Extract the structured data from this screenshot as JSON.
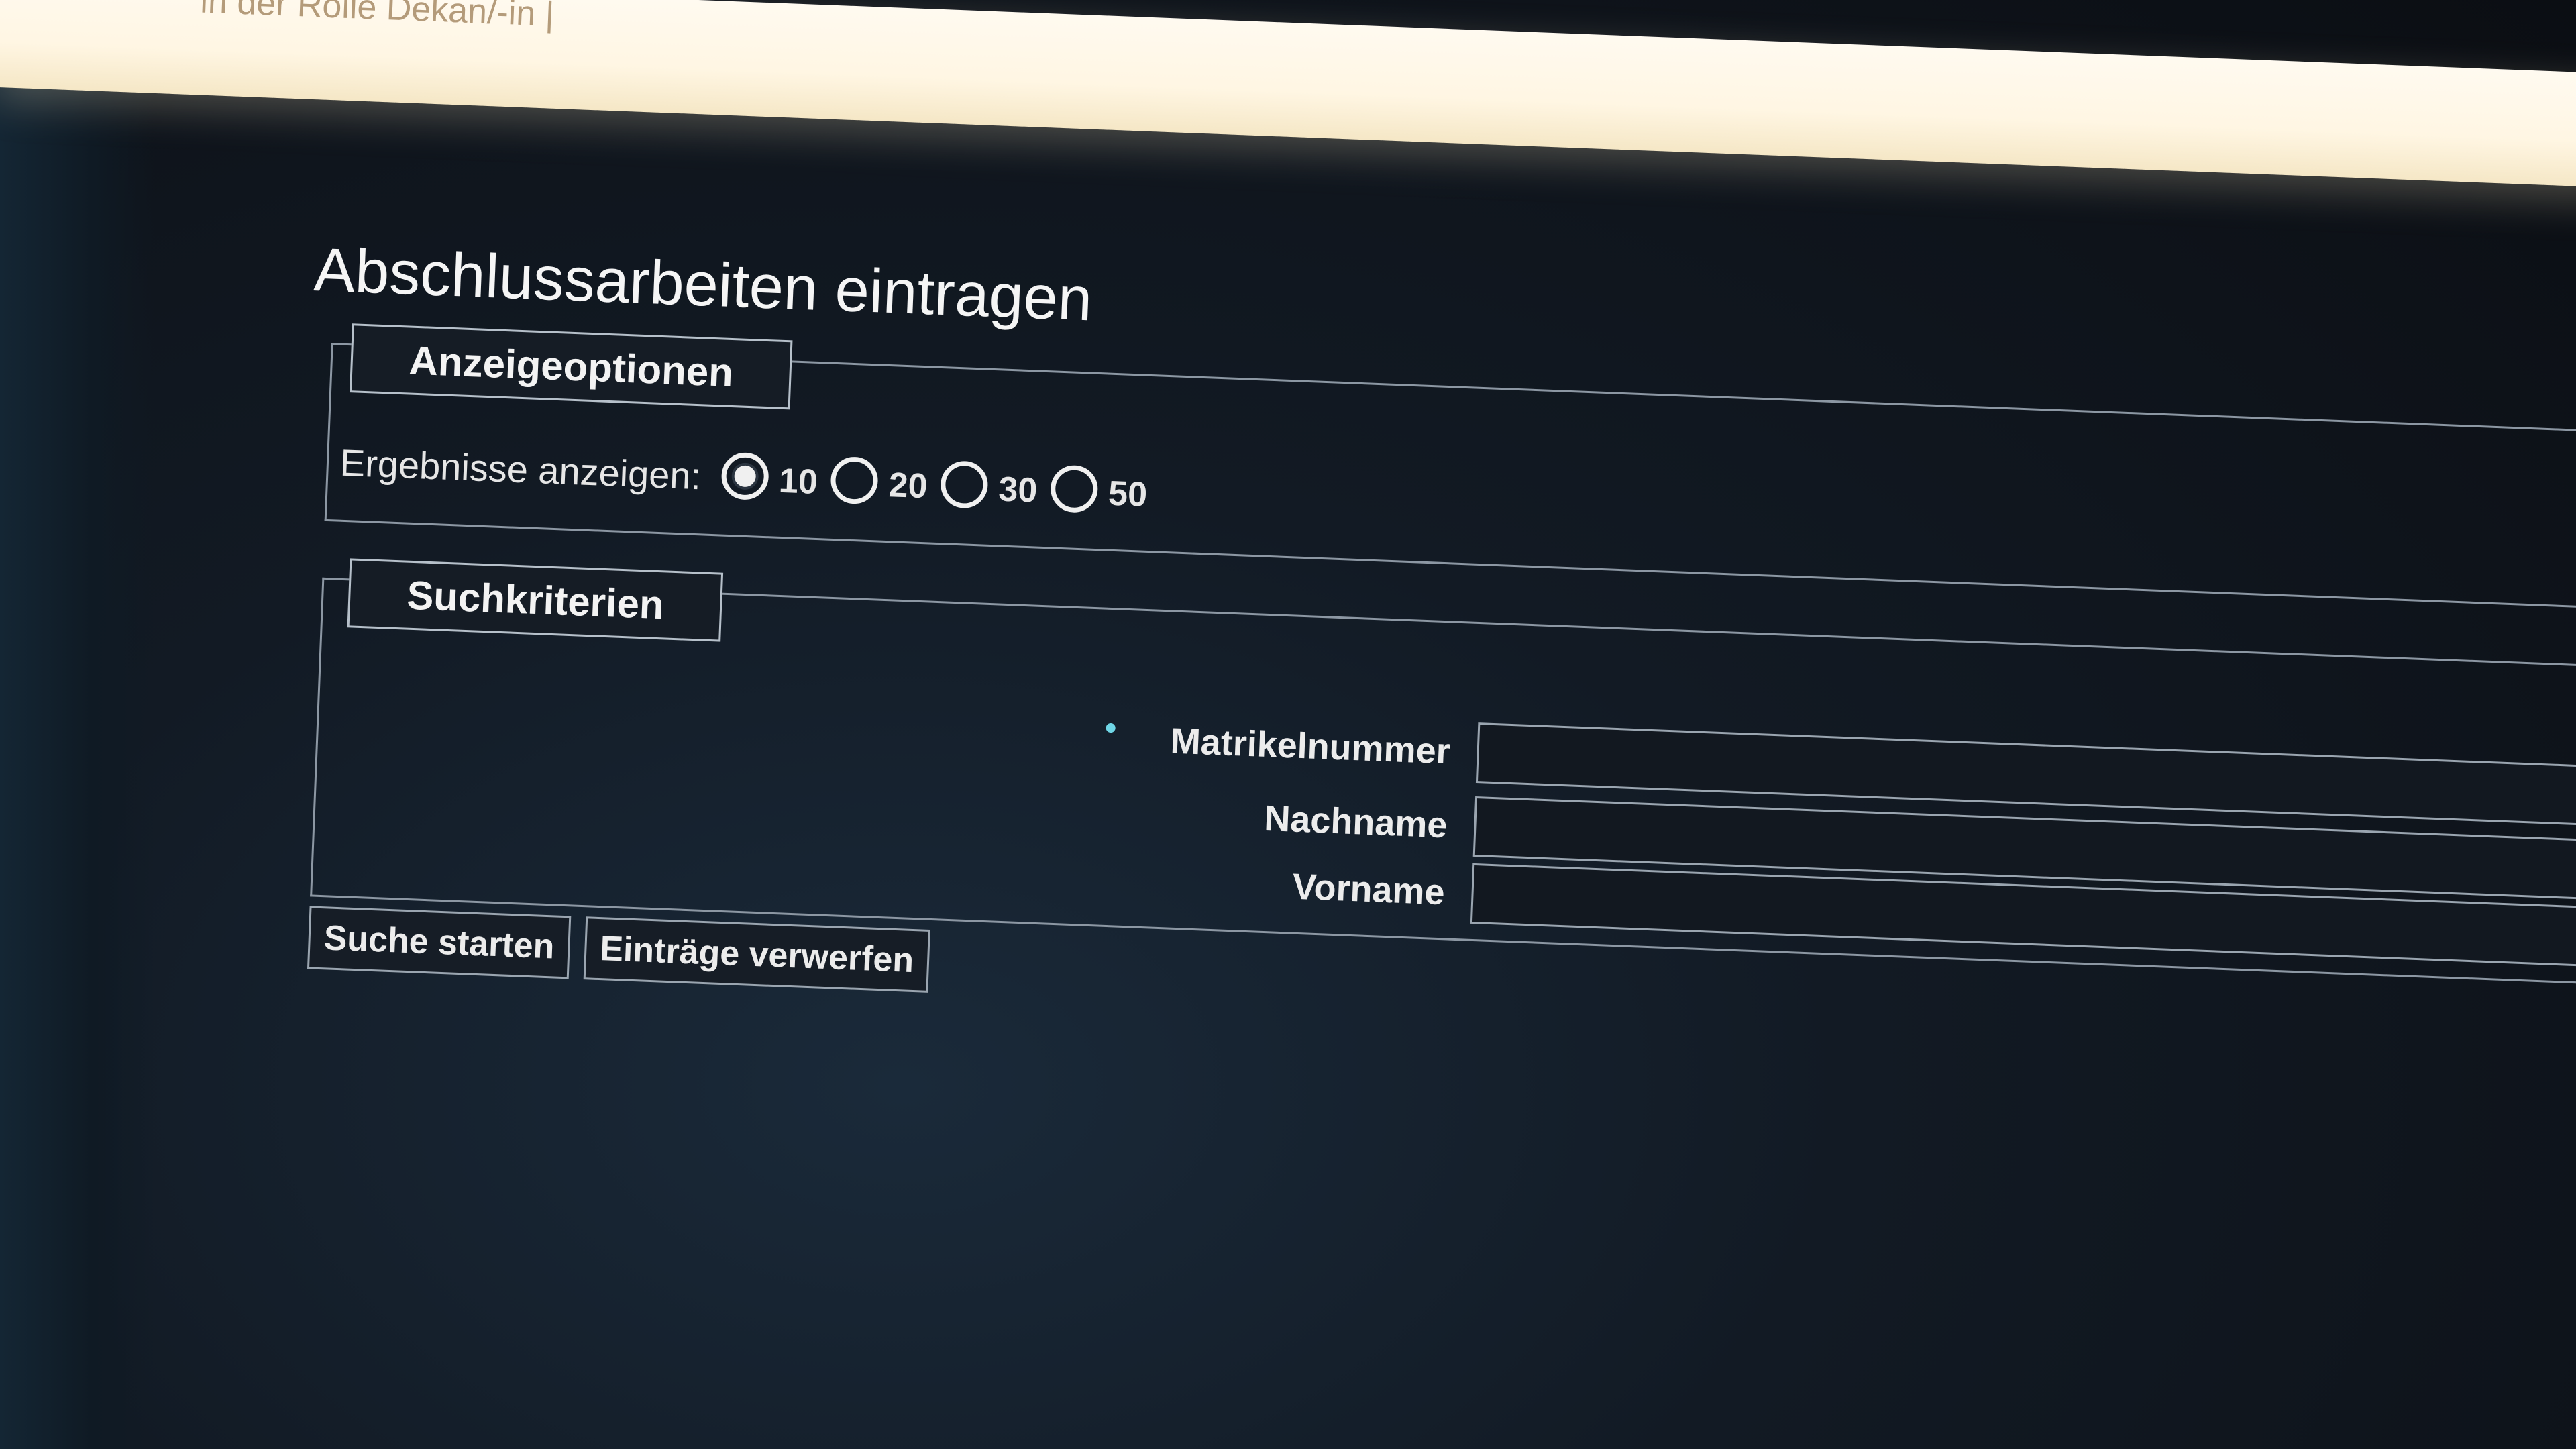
{
  "top_bar": {
    "text": "in der Rolle  Dekan/-in  |"
  },
  "page": {
    "title": "Abschlussarbeiten eintragen"
  },
  "display_options": {
    "legend": "Anzeigeoptionen",
    "results_label": "Ergebnisse anzeigen:",
    "options": [
      {
        "value": "10",
        "checked": true
      },
      {
        "value": "20",
        "checked": false
      },
      {
        "value": "30",
        "checked": false
      },
      {
        "value": "50",
        "checked": false
      }
    ]
  },
  "search_criteria": {
    "legend": "Suchkriterien",
    "fields": {
      "matrikelnummer": {
        "label": "Matrikelnummer",
        "value": "",
        "required": true
      },
      "nachname": {
        "label": "Nachname",
        "value": ""
      },
      "vorname": {
        "label": "Vorname",
        "value": ""
      }
    }
  },
  "buttons": {
    "search": "Suche starten",
    "discard": "Einträge verwerfen"
  }
}
